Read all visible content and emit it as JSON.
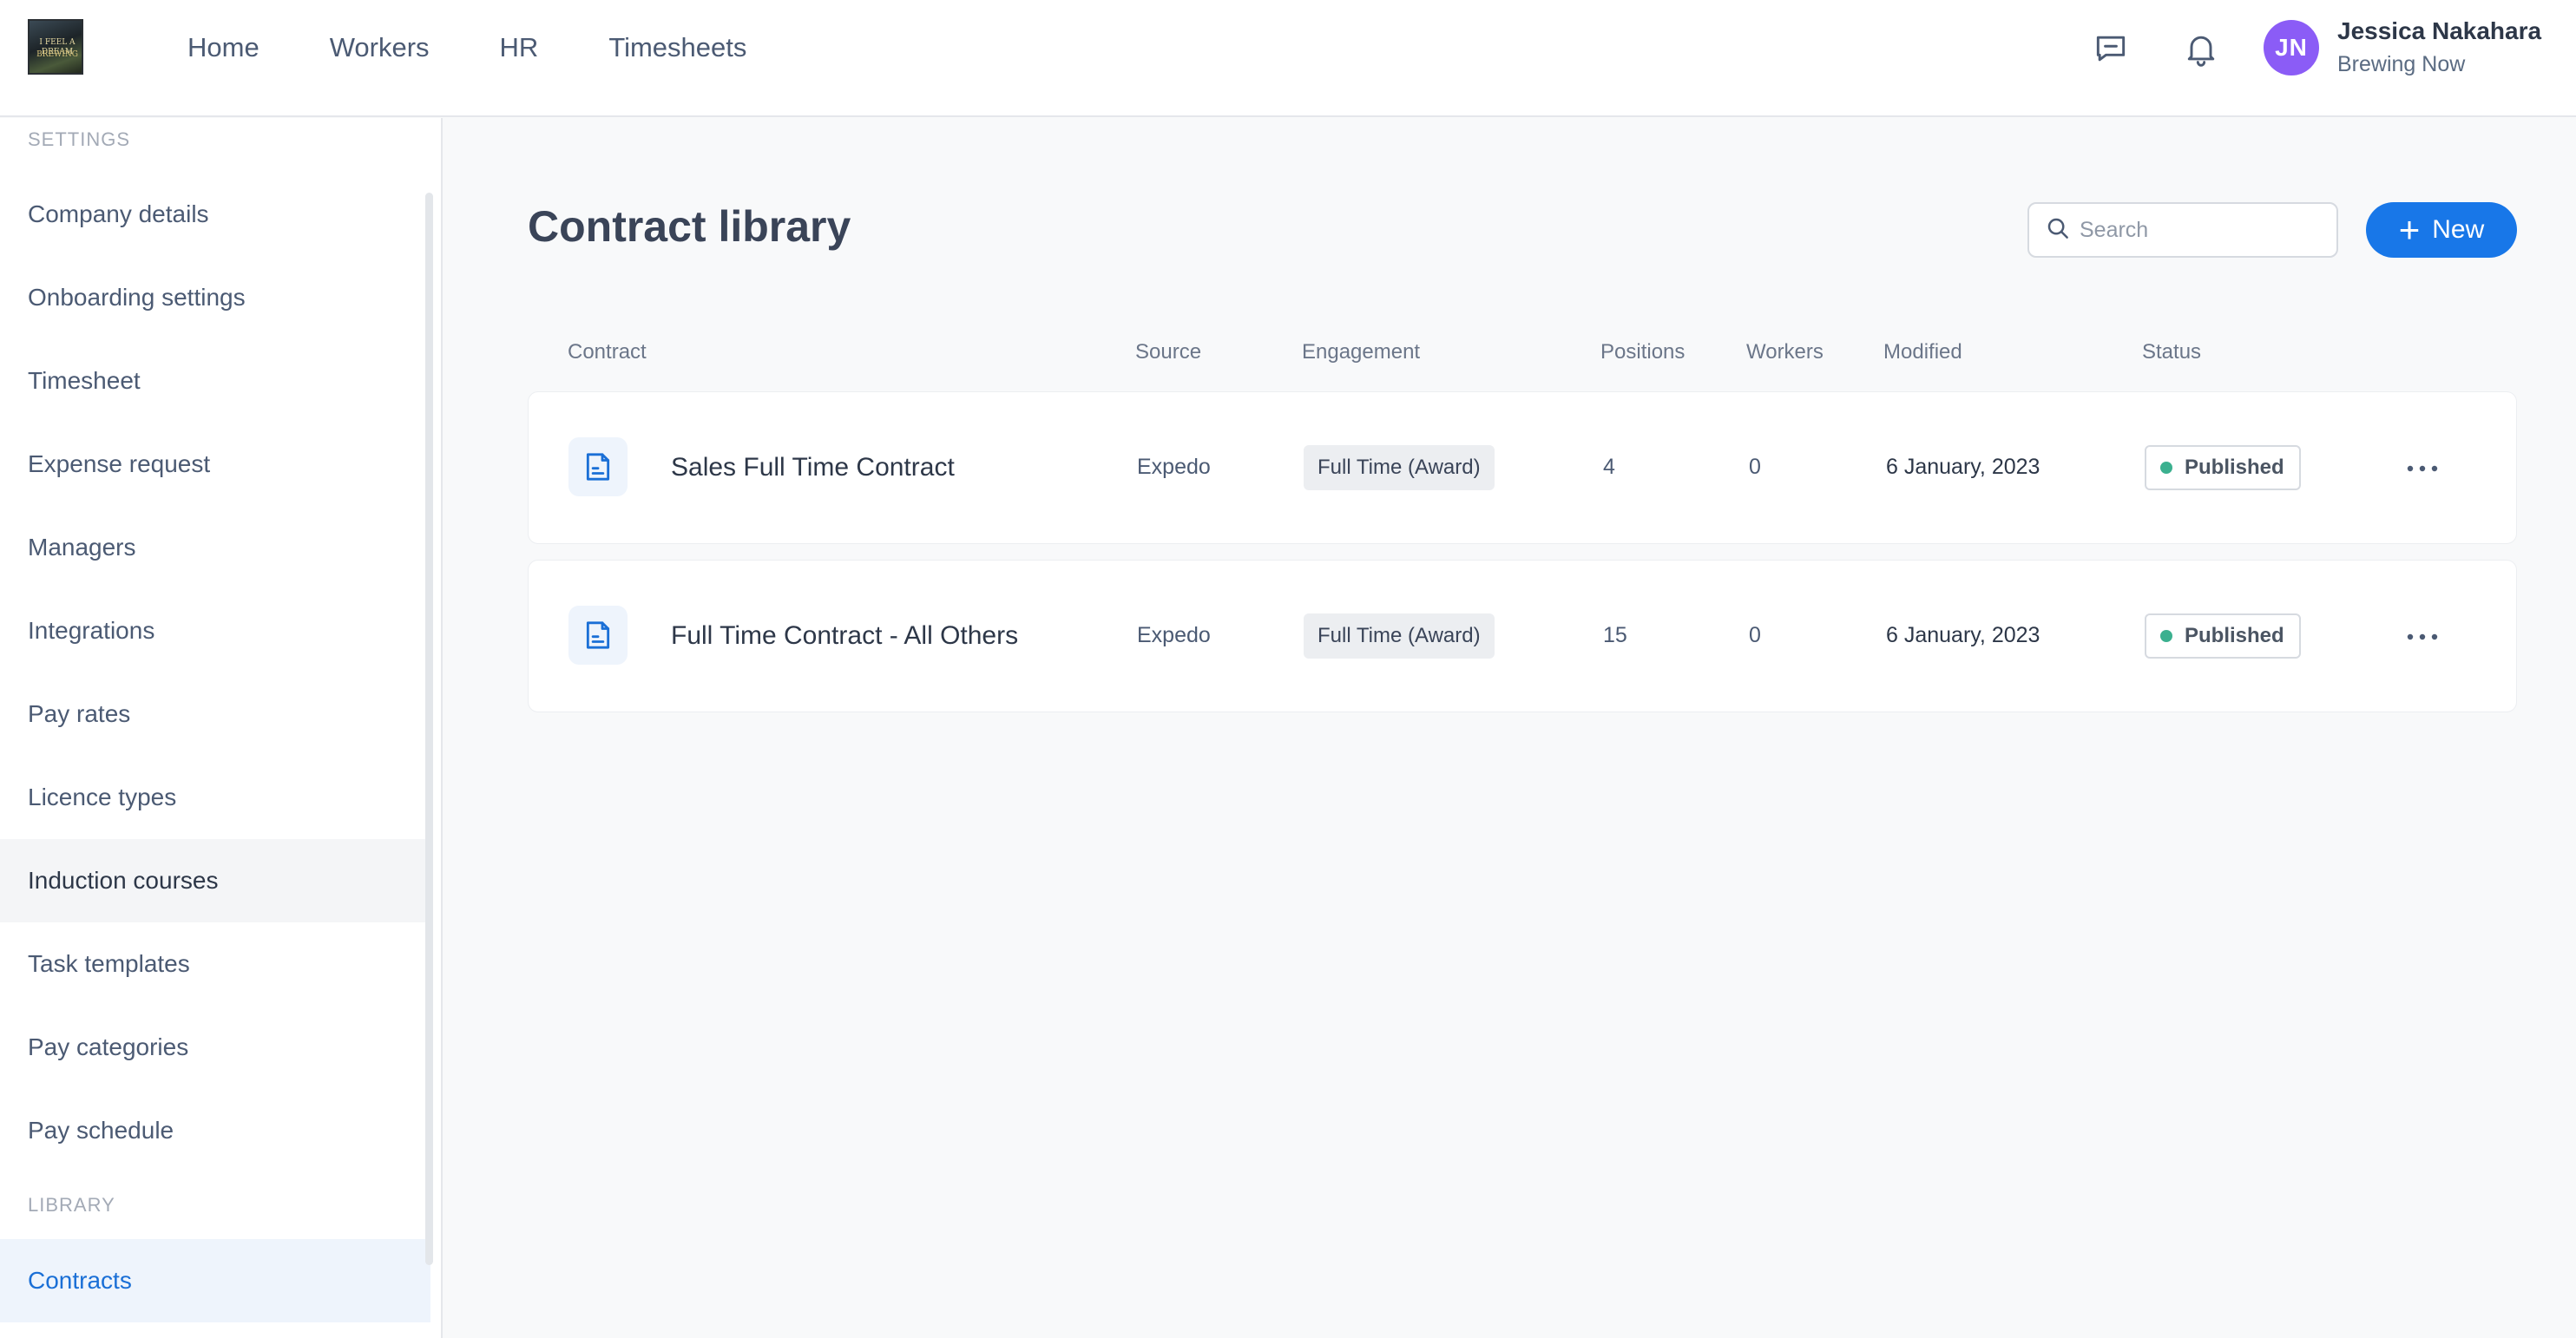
{
  "header": {
    "logo": {
      "line1": "I FEEL A DREAM",
      "line2": "BREWING"
    },
    "nav": [
      "Home",
      "Workers",
      "HR",
      "Timesheets"
    ],
    "icons": [
      "chat-icon",
      "bell-icon"
    ],
    "user": {
      "initials": "JN",
      "name": "Jessica Nakahara",
      "company": "Brewing Now",
      "avatar_color": "#8b5cf6"
    }
  },
  "sidebar": {
    "settings_label": "SETTINGS",
    "settings_items": [
      "Company details",
      "Onboarding settings",
      "Timesheet",
      "Expense request",
      "Managers",
      "Integrations",
      "Pay rates",
      "Licence types",
      "Induction courses",
      "Task templates",
      "Pay categories",
      "Pay schedule"
    ],
    "hovered_item": "Induction courses",
    "library_label": "LIBRARY",
    "library_items": [
      "Contracts"
    ],
    "active_item": "Contracts"
  },
  "main": {
    "title": "Contract library",
    "search": {
      "placeholder": "Search",
      "value": ""
    },
    "new_button": "New",
    "accent_color": "#1877e8",
    "columns": [
      "Contract",
      "Source",
      "Engagement",
      "Positions",
      "Workers",
      "Modified",
      "Status"
    ],
    "rows": [
      {
        "name": "Sales Full Time Contract",
        "source": "Expedo",
        "engagement": "Full Time (Award)",
        "positions": "4",
        "workers": "0",
        "modified": "6 January, 2023",
        "status": "Published"
      },
      {
        "name": "Full Time Contract - All Others",
        "source": "Expedo",
        "engagement": "Full Time (Award)",
        "positions": "15",
        "workers": "0",
        "modified": "6 January, 2023",
        "status": "Published"
      }
    ],
    "status_color": "#3bb08f"
  }
}
